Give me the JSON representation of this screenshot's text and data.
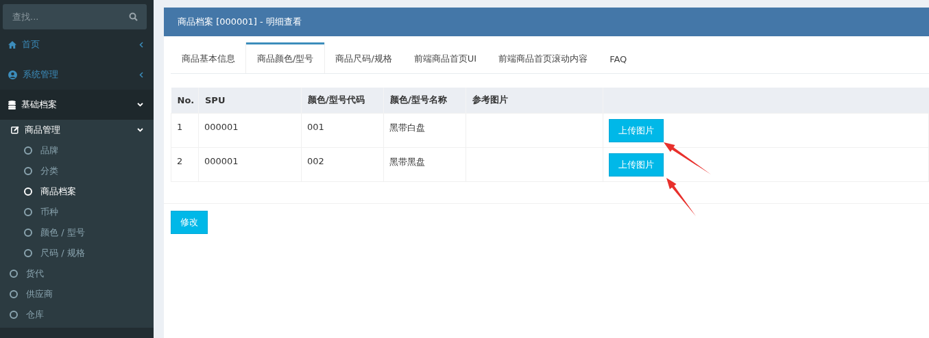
{
  "sidebar": {
    "search": {
      "placeholder": "查找..."
    },
    "items": [
      {
        "label": "首页",
        "kind": "home",
        "expanded": false
      },
      {
        "label": "系统管理",
        "kind": "account",
        "expanded": false
      },
      {
        "label": "基础档案",
        "kind": "database",
        "expanded": true,
        "children": [
          {
            "label": "商品管理",
            "kind": "edit",
            "expanded": true,
            "children": [
              {
                "label": "品牌",
                "selected": false
              },
              {
                "label": "分类",
                "selected": false
              },
              {
                "label": "商品档案",
                "selected": true
              },
              {
                "label": "币种",
                "selected": false
              },
              {
                "label": "颜色 / 型号",
                "selected": false
              },
              {
                "label": "尺码 / 规格",
                "selected": false
              }
            ]
          },
          {
            "label": "货代",
            "kind": "circle",
            "selected": false
          },
          {
            "label": "供应商",
            "kind": "circle",
            "selected": false
          },
          {
            "label": "仓库",
            "kind": "circle",
            "selected": false
          }
        ]
      }
    ]
  },
  "panel": {
    "title": "商品档案 [000001] - 明细查看",
    "tabs": [
      {
        "label": "商品基本信息",
        "selected": false
      },
      {
        "label": "商品颜色/型号",
        "selected": true
      },
      {
        "label": "商品尺码/规格",
        "selected": false
      },
      {
        "label": "前端商品首页UI",
        "selected": false
      },
      {
        "label": "前端商品首页滚动内容",
        "selected": false
      },
      {
        "label": "FAQ",
        "selected": false
      }
    ],
    "table": {
      "columns": [
        "No.",
        "SPU",
        "颜色/型号代码",
        "颜色/型号名称",
        "参考图片"
      ],
      "rows": [
        {
          "cells": [
            "1",
            "000001",
            "001",
            "黑带白盘"
          ],
          "button": "上传图片"
        },
        {
          "cells": [
            "2",
            "000001",
            "002",
            "黑带黑盘"
          ],
          "button": "上传图片"
        }
      ]
    },
    "edit_button": "修改"
  }
}
